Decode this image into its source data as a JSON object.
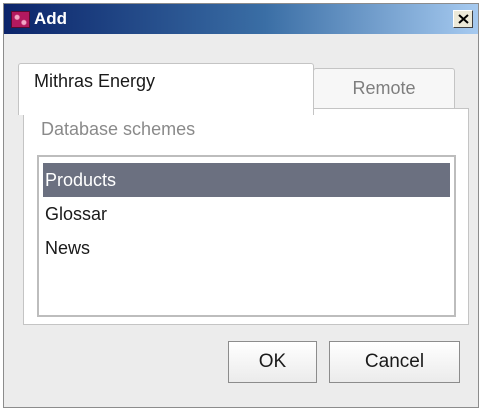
{
  "window": {
    "title": "Add",
    "app_icon": "app-logo-icon",
    "close_icon": "close-icon"
  },
  "tabs": [
    {
      "label": "Mithras Energy",
      "active": true
    },
    {
      "label": "Remote",
      "active": false
    }
  ],
  "section": {
    "label": "Database schemes"
  },
  "list": {
    "items": [
      {
        "label": "Products",
        "selected": true
      },
      {
        "label": "Glossar",
        "selected": false
      },
      {
        "label": "News",
        "selected": false
      }
    ]
  },
  "buttons": {
    "ok_label": "OK",
    "cancel_label": "Cancel"
  },
  "colors": {
    "selection": "#6b7080",
    "titlebar_start": "#0b246a",
    "titlebar_end": "#a6caf0"
  }
}
